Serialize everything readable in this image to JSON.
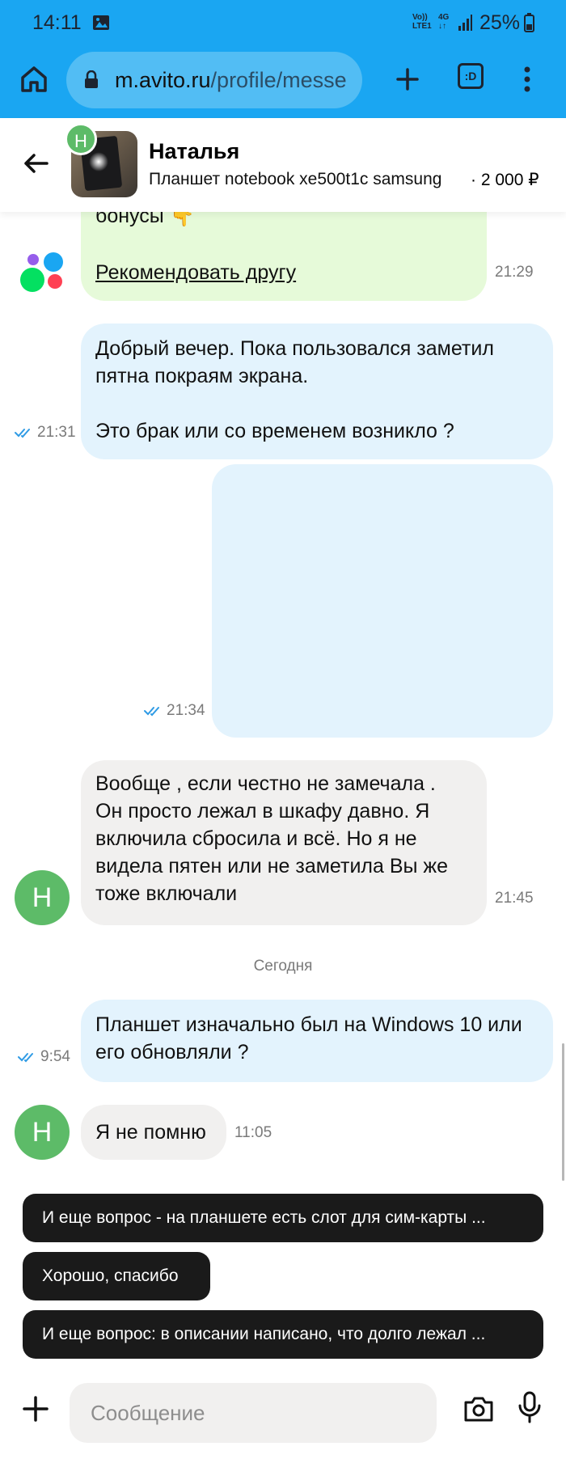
{
  "status_bar": {
    "time": "14:11",
    "network_top": "Vo))",
    "network_bottom": "LTE1",
    "network2_top": "4G",
    "network2_bottom": "↓↑",
    "battery": "25%"
  },
  "browser": {
    "url_host": "m.avito.ru",
    "url_path": "/profile/messe",
    "tabs_label": ":D"
  },
  "header": {
    "contact_initial": "Н",
    "name": "Наталья",
    "item_title": "Планшет notebook xe500t1c samsung",
    "price": "· 2 000 ₽"
  },
  "messages": [
    {
      "type": "promo",
      "line1": "бонусы 👇",
      "link": "Рекомендовать другу",
      "time": "21:29"
    },
    {
      "type": "out",
      "text1": "Добрый вечер. Пока пользовался заметил",
      "text2": "пятна покраям экрана.",
      "text3": "Это брак или со временем возникло ?",
      "time": "21:31"
    },
    {
      "type": "out-image",
      "time": "21:34"
    },
    {
      "type": "in",
      "initial": "Н",
      "l1": "Вообще , если честно не замечала .",
      "l2": "Он просто лежал в шкафу давно. Я",
      "l3": "включила сбросила и всё. Но я не",
      "l4": "видела пятен или не заметила Вы же",
      "l5": "тоже включали",
      "time": "21:45"
    },
    {
      "type": "date",
      "text": "Сегодня"
    },
    {
      "type": "out",
      "l1": "Планшет изначально был на Windows 10 или",
      "l2": "его обновляли ?",
      "time": "9:54"
    },
    {
      "type": "in",
      "initial": "Н",
      "text": "Я не помню",
      "time": "11:05"
    }
  ],
  "quick_replies": [
    "И еще вопрос - на планшете есть слот для сим-карты ...",
    "Хорошо, спасибо",
    "И еще вопрос: в описании написано, что долго лежал ..."
  ],
  "input": {
    "placeholder": "Сообщение"
  },
  "colors": {
    "browser_bar": "#1aa6f2",
    "outgoing_bubble": "#e3f3fd",
    "incoming_bubble": "#f1f0ef",
    "promo_bubble": "#e6fad9",
    "avatar": "#5dbb68",
    "quick_reply_bg": "#1a1a1a",
    "read_ticks": "#2f9be5"
  },
  "icons": [
    "image-icon",
    "signal-icon",
    "battery-icon",
    "home-icon",
    "lock-icon",
    "plus-icon",
    "tabs-icon",
    "kebab-icon",
    "back-icon",
    "avito-logo-icon",
    "read-ticks-icon",
    "attach-plus-icon",
    "camera-icon",
    "mic-icon"
  ]
}
